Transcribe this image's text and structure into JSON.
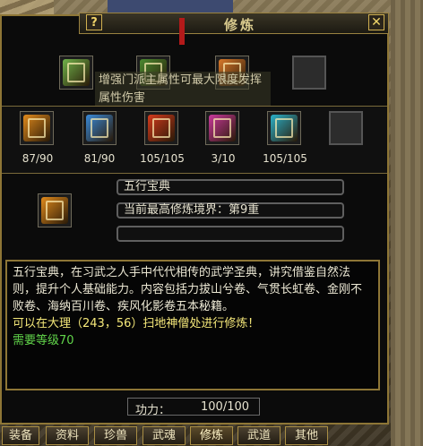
{
  "window": {
    "title": "修炼",
    "help_label": "?",
    "close_label": "✕"
  },
  "tooltip": {
    "text": "增强门派主属性可最大限度发挥属性伤害"
  },
  "top_slots": [
    {
      "icon": "book-green-icon",
      "color": "#6fb24a"
    },
    {
      "icon": "book-green-red-icon",
      "color": "#4a8a30"
    },
    {
      "icon": "book-orange-icon",
      "color": "#d8782a"
    },
    {
      "icon": "empty-slot",
      "color": ""
    }
  ],
  "books": [
    {
      "icon": "book-orange-icon",
      "color": "#e08a1c",
      "count": "87/90"
    },
    {
      "icon": "book-blue-green-icon",
      "color": "#3a8ad8",
      "count": "81/90"
    },
    {
      "icon": "book-red-icon",
      "color": "#d43a1c",
      "count": "105/105"
    },
    {
      "icon": "book-magenta-icon",
      "color": "#c8389a",
      "count": "3/10"
    },
    {
      "icon": "book-cyan-icon",
      "color": "#2ab0c8",
      "count": "105/105"
    }
  ],
  "detail": {
    "name": "五行宝典",
    "realm": "当前最高修炼境界：第9重",
    "extra": ""
  },
  "description": {
    "text": "五行宝典，在习武之人手中代代相传的武学圣典，讲究借鉴自然法则，提升个人基础能力。内容包括力拔山兮卷、气贯长虹卷、金刚不败卷、海纳百川卷、疾风化影卷五本秘籍。",
    "location": "可以在大理（243，56）扫地神僧处进行修炼！",
    "requirement": "需要等级70"
  },
  "power": {
    "label": "功力：",
    "value": "100/100"
  },
  "tabs": [
    "装备",
    "资料",
    "珍兽",
    "武魂",
    "修炼",
    "武道",
    "其他"
  ],
  "active_tab": "修炼"
}
